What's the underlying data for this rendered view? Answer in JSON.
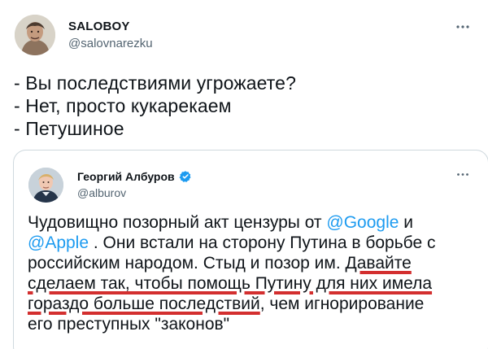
{
  "author": {
    "name": "SALOBOY",
    "handle": "@salovnarezku"
  },
  "tweet": {
    "text": "- Вы последствиями угрожаете?\n- Нет, просто кукарекаем\n- Петушиное"
  },
  "quoted": {
    "author": {
      "name": "Георгий Албуров",
      "handle": "@alburov",
      "verified": true
    },
    "text_parts": {
      "p1": "Чудовищно позорный акт цензуры от ",
      "mention_google": "@Google",
      "p2": " и",
      "mention_apple": "@Apple",
      "p3": " . Они встали на сторону Путина в борьбе с",
      "p4": "российским народом. Стыд и позор им. ",
      "u1": "Давайте",
      "u2": "сделаем так, чтобы помощь Путину для них имела",
      "u3": "гораздо больше последствий",
      "p5": ", чем игнорирование",
      "p6": "его преступных \"законов\""
    }
  },
  "icons": {
    "more": "more-horizontal-icon",
    "verified": "verified-badge-icon"
  },
  "colors": {
    "link": "#1d9bf0",
    "secondary_text": "#536471",
    "border": "#cfd9de",
    "verified": "#1d9bf0",
    "underline": "#d32f2f"
  }
}
